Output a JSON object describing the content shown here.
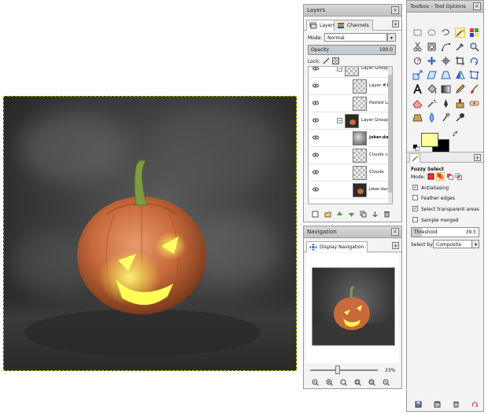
{
  "layers_panel": {
    "title": "Layers",
    "tabs": [
      "Layers",
      "Channels"
    ],
    "mode_label": "Mode:",
    "mode_value": "Normal",
    "opacity_label": "Opacity",
    "opacity_value": "100.0",
    "lock_label": "Lock:",
    "layers": [
      {
        "name": "Layer Group",
        "thumb": "group",
        "indent": 1
      },
      {
        "name": "Layer #1",
        "thumb": "checker",
        "indent": 2
      },
      {
        "name": "Pasted La",
        "thumb": "checker",
        "indent": 2
      },
      {
        "name": "Layer Group",
        "thumb": "pumpkin",
        "indent": 1
      },
      {
        "name": "joker.dar",
        "thumb": "cloud",
        "indent": 2,
        "bold": true
      },
      {
        "name": "Clouds co",
        "thumb": "checker",
        "indent": 2
      },
      {
        "name": "Clouds",
        "thumb": "checker",
        "indent": 2
      },
      {
        "name": "joker.dar",
        "thumb": "pumpkin",
        "indent": 2
      }
    ]
  },
  "navigation_panel": {
    "title": "Navigation",
    "tab": "Display Navigation",
    "zoom_value": "33%"
  },
  "toolbox": {
    "title": "Toolbox - Tool Options",
    "tool_name": "Fuzzy Select",
    "mode_label": "Mode:",
    "options": [
      {
        "label": "Antialiasing",
        "checked": true
      },
      {
        "label": "Feather edges",
        "checked": false
      },
      {
        "label": "Select transparent areas",
        "checked": true
      },
      {
        "label": "Sample merged",
        "checked": false
      }
    ],
    "threshold_label": "Threshold",
    "threshold_value": "39.5",
    "select_by_label": "Select by:",
    "select_by_value": "Composite",
    "fg_color": "#ffff99",
    "bg_color": "#000000"
  }
}
